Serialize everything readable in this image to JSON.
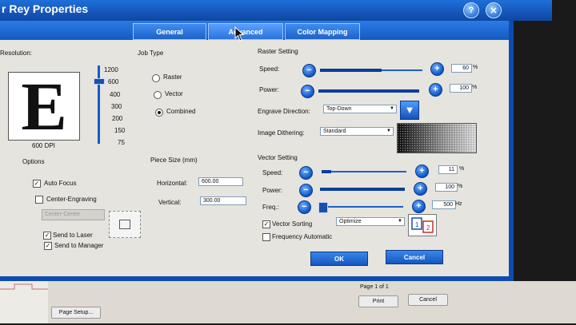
{
  "window": {
    "title": "r Rey Properties",
    "help_icon": "?",
    "close_icon": "✕"
  },
  "tabs": [
    {
      "label": "General",
      "active": false
    },
    {
      "label": "Advanced",
      "active": true
    },
    {
      "label": "Color Mapping",
      "active": false
    }
  ],
  "resolution": {
    "label": "Resolution:",
    "preview_letter": "E",
    "current": "600 DPI",
    "ticks": [
      "1200",
      "600",
      "400",
      "300",
      "200",
      "150",
      "75"
    ]
  },
  "job_type": {
    "label": "Job Type",
    "options": [
      "Raster",
      "Vector",
      "Combined"
    ],
    "selected": "Combined"
  },
  "raster": {
    "label": "Raster Setting",
    "speed_label": "Speed:",
    "speed_value": "60",
    "speed_unit": "%",
    "speed_level": 0.6,
    "power_label": "Power:",
    "power_value": "100",
    "power_unit": "%",
    "power_level": 1.0,
    "engrave_label": "Engrave Direction:",
    "engrave_value": "Top-Down",
    "dither_label": "Image Dithering:",
    "dither_value": "Standard"
  },
  "options": {
    "label": "Options",
    "auto_focus": "Auto Focus",
    "center_engraving": "Center-Engraving",
    "center_select": "Center-Center",
    "send_to_laser": "Send to Laser",
    "send_to_manager": "Send to Manager"
  },
  "piece_size": {
    "label": "Piece Size (mm)",
    "horizontal_label": "Horizontal:",
    "horizontal_value": "600.00",
    "vertical_label": "Vertical:",
    "vertical_value": "300.00"
  },
  "vector": {
    "label": "Vector Setting",
    "speed_label": "Speed:",
    "speed_value": "11",
    "speed_unit": "%",
    "speed_level": 0.11,
    "power_label": "Power:",
    "power_value": "100",
    "power_unit": "%",
    "power_level": 1.0,
    "freq_label": "Freq.:",
    "freq_value": "500",
    "freq_unit": "Hz",
    "freq_level": 0.0,
    "sorting_label": "Vector Sorting",
    "sorting_value": "Optimize",
    "auto_freq_label": "Frequency Automatic"
  },
  "buttons": {
    "ok": "OK",
    "cancel": "Cancel",
    "minus": "−",
    "plus": "+"
  },
  "background_window": {
    "page_info": "Page 1 of 1",
    "print": "Print",
    "cancel": "Cancel",
    "page_setup": "Page Setup..."
  }
}
